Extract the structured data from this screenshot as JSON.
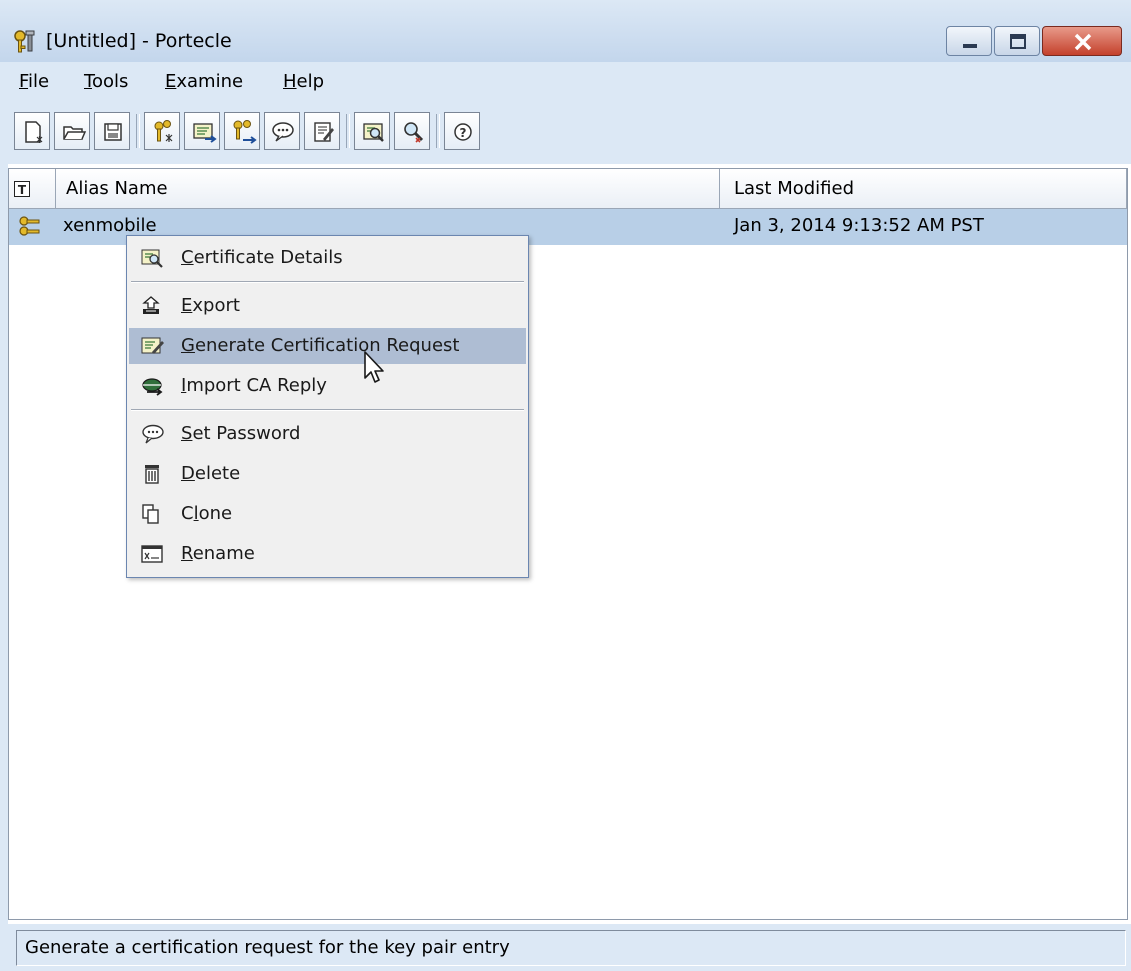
{
  "window": {
    "title": "[Untitled] - Portecle",
    "controls": [
      "minimize",
      "maximize",
      "close"
    ]
  },
  "menubar": {
    "items": [
      {
        "label": "File",
        "mnemonic": "F",
        "rest": "ile"
      },
      {
        "label": "Tools",
        "mnemonic": "T",
        "rest": "ools"
      },
      {
        "label": "Examine",
        "mnemonic": "E",
        "rest": "xamine"
      },
      {
        "label": "Help",
        "mnemonic": "H",
        "rest": "elp"
      }
    ]
  },
  "toolbar": {
    "buttons": [
      "new-keystore-icon",
      "open-keystore-icon",
      "save-keystore-icon",
      "generate-key-pair-icon",
      "import-trusted-certificate-icon",
      "import-key-pair-icon",
      "set-keystore-password-icon",
      "keystore-report-icon",
      "examine-certificate-icon",
      "examine-crl-icon",
      "help-icon"
    ]
  },
  "table": {
    "columns": {
      "type_icon": "T",
      "alias": "Alias Name",
      "modified": "Last Modified"
    },
    "rows": [
      {
        "alias": "xenmobile",
        "last_modified": "Jan 3, 2014 9:13:52 AM PST",
        "entry_icon": "key-pair-icon",
        "selected": true
      }
    ]
  },
  "context_menu": {
    "items": [
      {
        "pre": "",
        "u": "C",
        "post": "ertificate Details",
        "icon": "certificate-details-icon"
      },
      {
        "pre": "",
        "u": "E",
        "post": "xport",
        "icon": "export-icon"
      },
      {
        "pre": "",
        "u": "G",
        "post": "enerate Certification Request",
        "icon": "generate-csr-icon",
        "highlighted": true
      },
      {
        "pre": "",
        "u": "I",
        "post": "mport CA Reply",
        "icon": "import-ca-reply-icon"
      },
      {
        "pre": "",
        "u": "S",
        "post": "et Password",
        "icon": "set-password-icon"
      },
      {
        "pre": "",
        "u": "D",
        "post": "elete",
        "icon": "delete-icon"
      },
      {
        "pre": "C",
        "u": "l",
        "post": "one",
        "icon": "clone-icon"
      },
      {
        "pre": "",
        "u": "R",
        "post": "ename",
        "icon": "rename-icon"
      }
    ]
  },
  "statusbar": {
    "text": "Generate a certification request for the key pair entry"
  },
  "colors": {
    "chrome": "#dce8f5",
    "selection": "#b8cfe7",
    "menu_highlight": "#aebdd3",
    "close_button": "#c4412c"
  }
}
